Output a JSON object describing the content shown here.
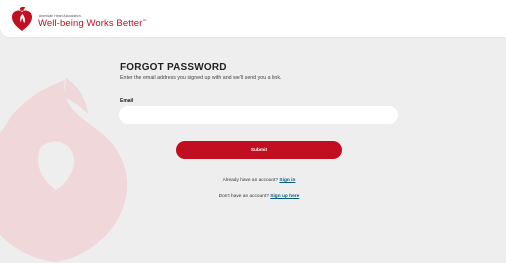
{
  "brand": {
    "org_name": "American Heart Association.",
    "tagline": "Well-being Works Better",
    "trademark": "™",
    "color": "#c10e21"
  },
  "form": {
    "title": "FORGOT PASSWORD",
    "subtitle": "Enter the email address you signed up with and we'll send you a link.",
    "email_label": "Email",
    "email_value": "",
    "submit_label": "Submit"
  },
  "links": {
    "signin_prompt": "Already have an account?",
    "signin_link": "Sign in",
    "signup_prompt": "Don't have an account?",
    "signup_link": "Sign up here"
  }
}
